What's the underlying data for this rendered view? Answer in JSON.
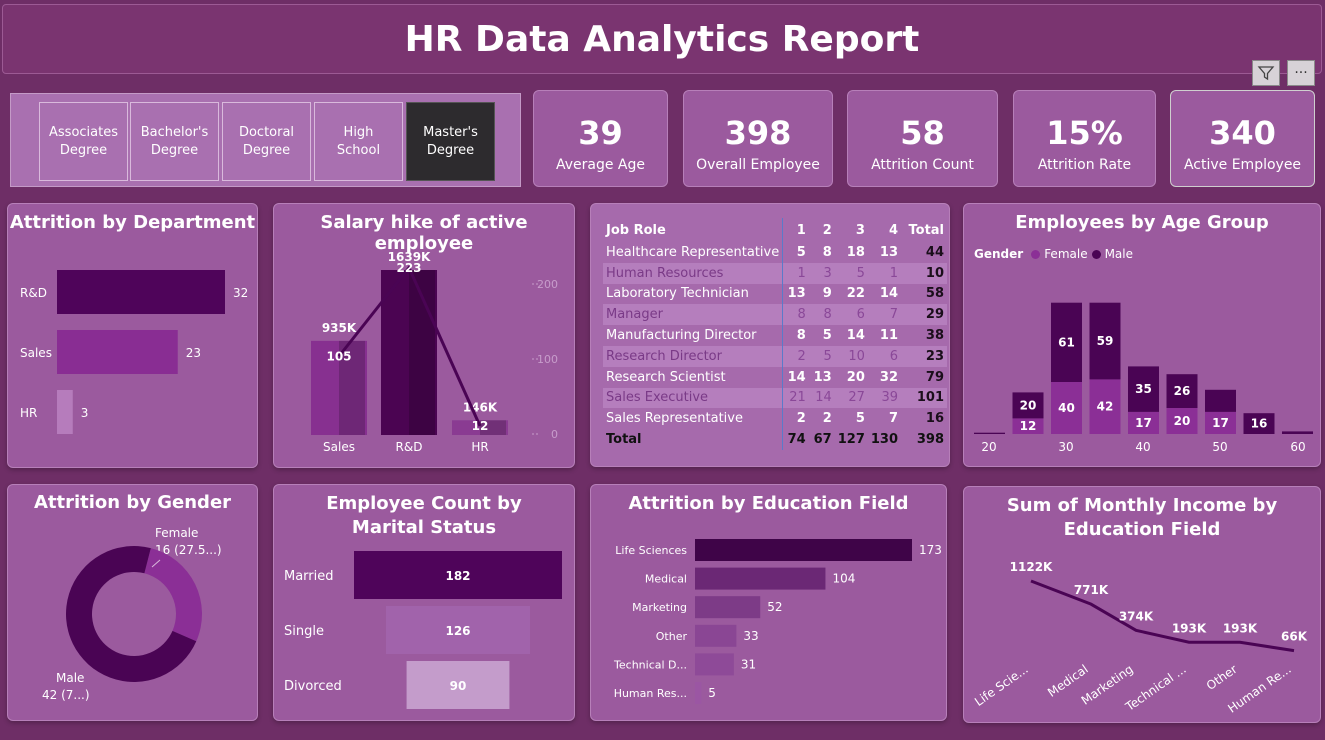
{
  "header": {
    "title": "HR Data Analytics Report"
  },
  "toolbar": {
    "filter_icon": "filter-icon",
    "more_label": "···"
  },
  "slicer": {
    "items": [
      {
        "label": "Associates Degree",
        "selected": false
      },
      {
        "label": "Bachelor's Degree",
        "selected": false
      },
      {
        "label": "Doctoral Degree",
        "selected": false
      },
      {
        "label": "High School",
        "selected": false
      },
      {
        "label": "Master's Degree",
        "selected": true
      }
    ]
  },
  "kpis": [
    {
      "value": "39",
      "label": "Average Age"
    },
    {
      "value": "398",
      "label": "Overall Employee"
    },
    {
      "value": "58",
      "label": "Attrition Count"
    },
    {
      "value": "15%",
      "label": "Attrition Rate"
    },
    {
      "value": "340",
      "label": "Active Employee"
    }
  ],
  "attrition_department": {
    "title": "Attrition by Department",
    "chart_data": {
      "type": "bar",
      "categories": [
        "R&D",
        "Sales",
        "HR"
      ],
      "values": [
        32,
        23,
        3
      ]
    }
  },
  "salary_hike": {
    "title": "Salary hike of active employee",
    "chart_data": {
      "type": "bar",
      "categories": [
        "Sales",
        "R&D",
        "HR"
      ],
      "bar_labels": [
        "935K",
        "1639K",
        "146K"
      ],
      "values": [
        935,
        1639,
        146
      ],
      "line_values": [
        105,
        223,
        12
      ],
      "y2_ticks": [
        "200",
        "100",
        "0"
      ],
      "y2lim": [
        0,
        240
      ]
    }
  },
  "job_role": {
    "header": {
      "role": "Job Role",
      "cols": [
        "1",
        "2",
        "3",
        "4"
      ],
      "total": "Total"
    },
    "rows": [
      {
        "role": "Healthcare Representative",
        "v": [
          "5",
          "8",
          "18",
          "13"
        ],
        "total": "44"
      },
      {
        "role": "Human Resources",
        "v": [
          "1",
          "3",
          "5",
          "1"
        ],
        "total": "10"
      },
      {
        "role": "Laboratory Technician",
        "v": [
          "13",
          "9",
          "22",
          "14"
        ],
        "total": "58"
      },
      {
        "role": "Manager",
        "v": [
          "8",
          "8",
          "6",
          "7"
        ],
        "total": "29"
      },
      {
        "role": "Manufacturing Director",
        "v": [
          "8",
          "5",
          "14",
          "11"
        ],
        "total": "38"
      },
      {
        "role": "Research Director",
        "v": [
          "2",
          "5",
          "10",
          "6"
        ],
        "total": "23"
      },
      {
        "role": "Research Scientist",
        "v": [
          "14",
          "13",
          "20",
          "32"
        ],
        "total": "79"
      },
      {
        "role": "Sales Executive",
        "v": [
          "21",
          "14",
          "27",
          "39"
        ],
        "total": "101"
      },
      {
        "role": "Sales Representative",
        "v": [
          "2",
          "2",
          "5",
          "7"
        ],
        "total": "16"
      }
    ],
    "total_row": {
      "role": "Total",
      "v": [
        "74",
        "67",
        "127",
        "130"
      ],
      "total": "398"
    }
  },
  "age_group": {
    "title": "Employees by Age Group",
    "legend": {
      "label": "Gender",
      "female": "Female",
      "male": "Male"
    },
    "colors": {
      "female": "#8b2f96",
      "male": "#4a0454"
    },
    "chart_data": {
      "type": "bar",
      "x_ticks": [
        "20",
        "30",
        "40",
        "50",
        "60"
      ],
      "bins": [
        {
          "female": 0,
          "male": 1
        },
        {
          "female": 12,
          "male": 20
        },
        {
          "female": 40,
          "male": 61
        },
        {
          "female": 42,
          "male": 59
        },
        {
          "female": 17,
          "male": 35
        },
        {
          "female": 20,
          "male": 26
        },
        {
          "female": 17,
          "male": 17
        },
        {
          "female": 0,
          "male": 16
        },
        {
          "female": 0,
          "male": 2
        }
      ],
      "labels": [
        {
          "female": "",
          "male": ""
        },
        {
          "female": "12",
          "male": "20"
        },
        {
          "female": "40",
          "male": "61"
        },
        {
          "female": "42",
          "male": "59"
        },
        {
          "female": "17",
          "male": "35"
        },
        {
          "female": "20",
          "male": "26"
        },
        {
          "female": "17",
          "male": ""
        },
        {
          "female": "",
          "male": "16"
        },
        {
          "female": "",
          "male": ""
        }
      ]
    }
  },
  "attrition_gender": {
    "title": "Attrition by Gender",
    "female_label": "Female",
    "female_value": "16 (27.5...)",
    "male_label": "Male",
    "male_value": "42 (7...)",
    "chart_data": {
      "type": "pie",
      "categories": [
        "Female",
        "Male"
      ],
      "values": [
        16,
        42
      ]
    }
  },
  "marital": {
    "title": "Employee Count by Marital Status",
    "chart_data": {
      "type": "bar",
      "categories": [
        "Married",
        "Single",
        "Divorced"
      ],
      "values": [
        182,
        126,
        90
      ]
    }
  },
  "education_field": {
    "title": "Attrition by Education Field",
    "chart_data": {
      "type": "bar",
      "categories": [
        "Life Sciences",
        "Medical",
        "Marketing",
        "Other",
        "Technical D...",
        "Human Res..."
      ],
      "values": [
        173,
        104,
        52,
        33,
        31,
        5
      ]
    }
  },
  "monthly_income": {
    "title": "Sum of Monthly Income by Education Field",
    "chart_data": {
      "type": "line",
      "categories": [
        "Life Scie...",
        "Medical",
        "Marketing",
        "Technical ...",
        "Other",
        "Human Re..."
      ],
      "values": [
        1122,
        771,
        374,
        193,
        193,
        66
      ],
      "labels": [
        "1122K",
        "771K",
        "374K",
        "193K",
        "193K",
        "66K"
      ]
    }
  }
}
